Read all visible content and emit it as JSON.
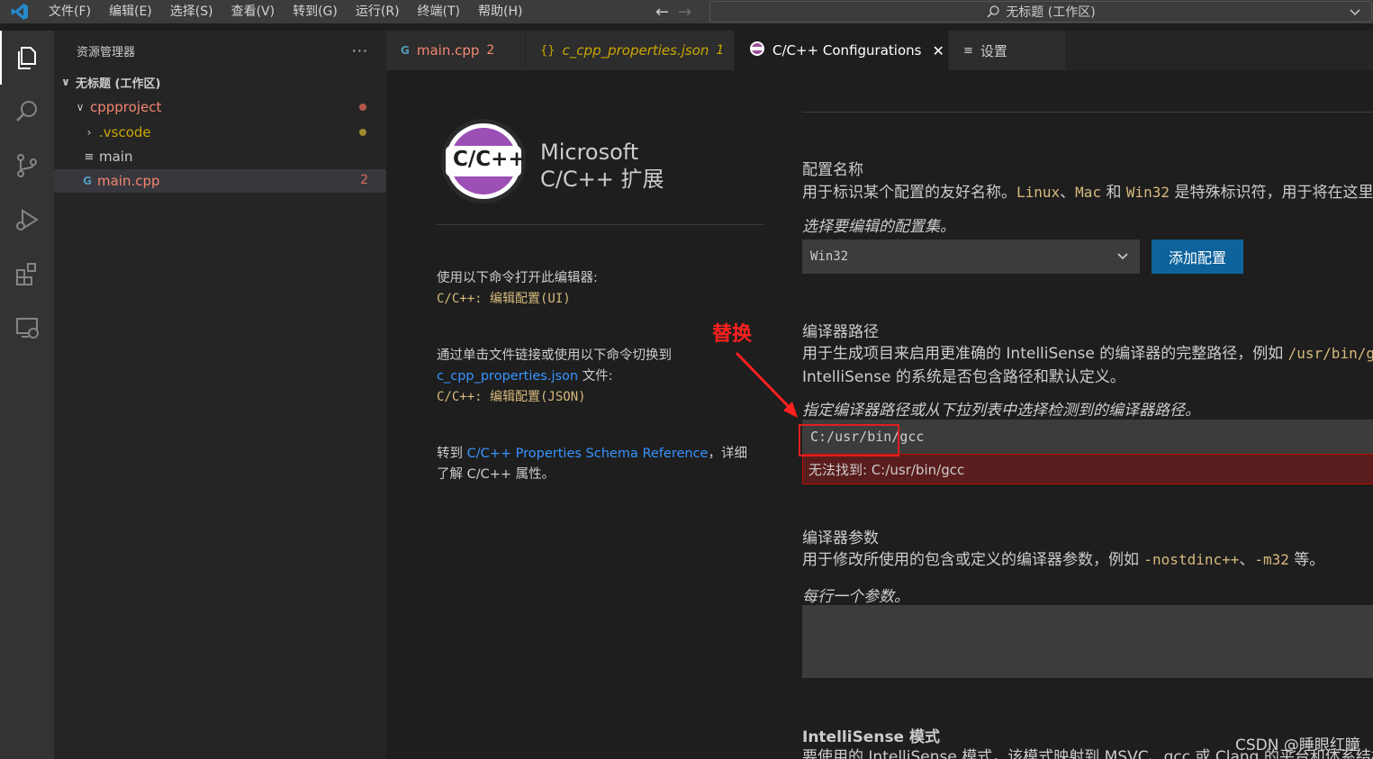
{
  "titlebar": {
    "menu": [
      "文件(F)",
      "编辑(E)",
      "选择(S)",
      "查看(V)",
      "转到(G)",
      "运行(R)",
      "终端(T)",
      "帮助(H)"
    ],
    "search_text": "无标题 (工作区)"
  },
  "sidebar": {
    "title": "资源管理器",
    "more": "···",
    "workspace": "无标题 (工作区)",
    "tree": [
      {
        "label": "cppproject",
        "color": "#f48771"
      },
      {
        "label": ".vscode",
        "color": "#cca700"
      },
      {
        "label": "main",
        "color": "#cccccc"
      },
      {
        "label": "main.cpp",
        "color": "#f48771",
        "badge": "2"
      }
    ],
    "dot_colors": {
      "cppproject": "#b4574b",
      "vscode": "#a08a2c"
    }
  },
  "tabs": [
    {
      "label": "main.cpp",
      "num": "2",
      "color": "#f48771",
      "icon": "cpp-icon"
    },
    {
      "label": "c_cpp_properties.json",
      "num": "1",
      "color": "#cca700",
      "icon": "json-icon"
    },
    {
      "label": "C/C++ Configurations",
      "close": "✕",
      "color": "#ffffff",
      "icon": "cpp-logo-icon"
    },
    {
      "label": "设置",
      "color": "#cccccc",
      "icon": "settings-file-icon"
    }
  ],
  "left_panel": {
    "logo_text": "C/C++",
    "brand_line1": "Microsoft",
    "brand_line2": "C/C++ 扩展",
    "info1_text": "使用以下命令打开此编辑器:",
    "info1_cmd": "C/C++: 编辑配置(UI)",
    "info2_text": "通过单击文件链接或使用以下命令切换到",
    "info2_link": "c_cpp_properties.json",
    "info2_suffix": " 文件:",
    "info2_cmd": "C/C++: 编辑配置(JSON)",
    "info3_prefix": "转到 ",
    "info3_link": "C/C++ Properties Schema Reference",
    "info3_suffix": "，详细",
    "info3_line2": "了解 C/C++ 属性。"
  },
  "config_name": {
    "title": "配置名称",
    "desc_prefix": "用于标识某个配置的友好名称。",
    "desc_code1": "Linux",
    "desc_sep1": "、",
    "desc_code2": "Mac",
    "desc_mid": " 和 ",
    "desc_code3": "Win32",
    "desc_suffix": " 是特殊标识符，用于将在这里",
    "hint": "选择要编辑的配置集。",
    "select_value": "Win32",
    "add_button": "添加配置"
  },
  "compiler_path": {
    "title": "编译器路径",
    "desc1_prefix": "用于生成项目来启用更准确的 IntelliSense 的编译器的完整路径，例如 ",
    "desc1_code": "/usr/bin/g",
    "desc2": "IntelliSense 的系统是否包含路径和默认定义。",
    "hint": "指定编译器路径或从下拉列表中选择检测到的编译器路径。",
    "value": "C:/usr/bin/gcc",
    "error": "无法找到: C:/usr/bin/gcc"
  },
  "compiler_args": {
    "title": "编译器参数",
    "desc_prefix": "用于修改所使用的包含或定义的编译器参数，例如 ",
    "desc_code1": "-nostdinc++",
    "desc_sep": "、",
    "desc_code2": "-m32",
    "desc_suffix": " 等。",
    "hint": "每行一个参数。"
  },
  "intellisense": {
    "title": "IntelliSense 模式",
    "desc": "要使用的 IntelliSense 模式，该模式映射到 MSVC、gcc 或 Clang 的平台和体系结构"
  },
  "annotation": {
    "text": "替换",
    "color": "#ff2020"
  },
  "watermark": "CSDN @睡眼红瞳"
}
